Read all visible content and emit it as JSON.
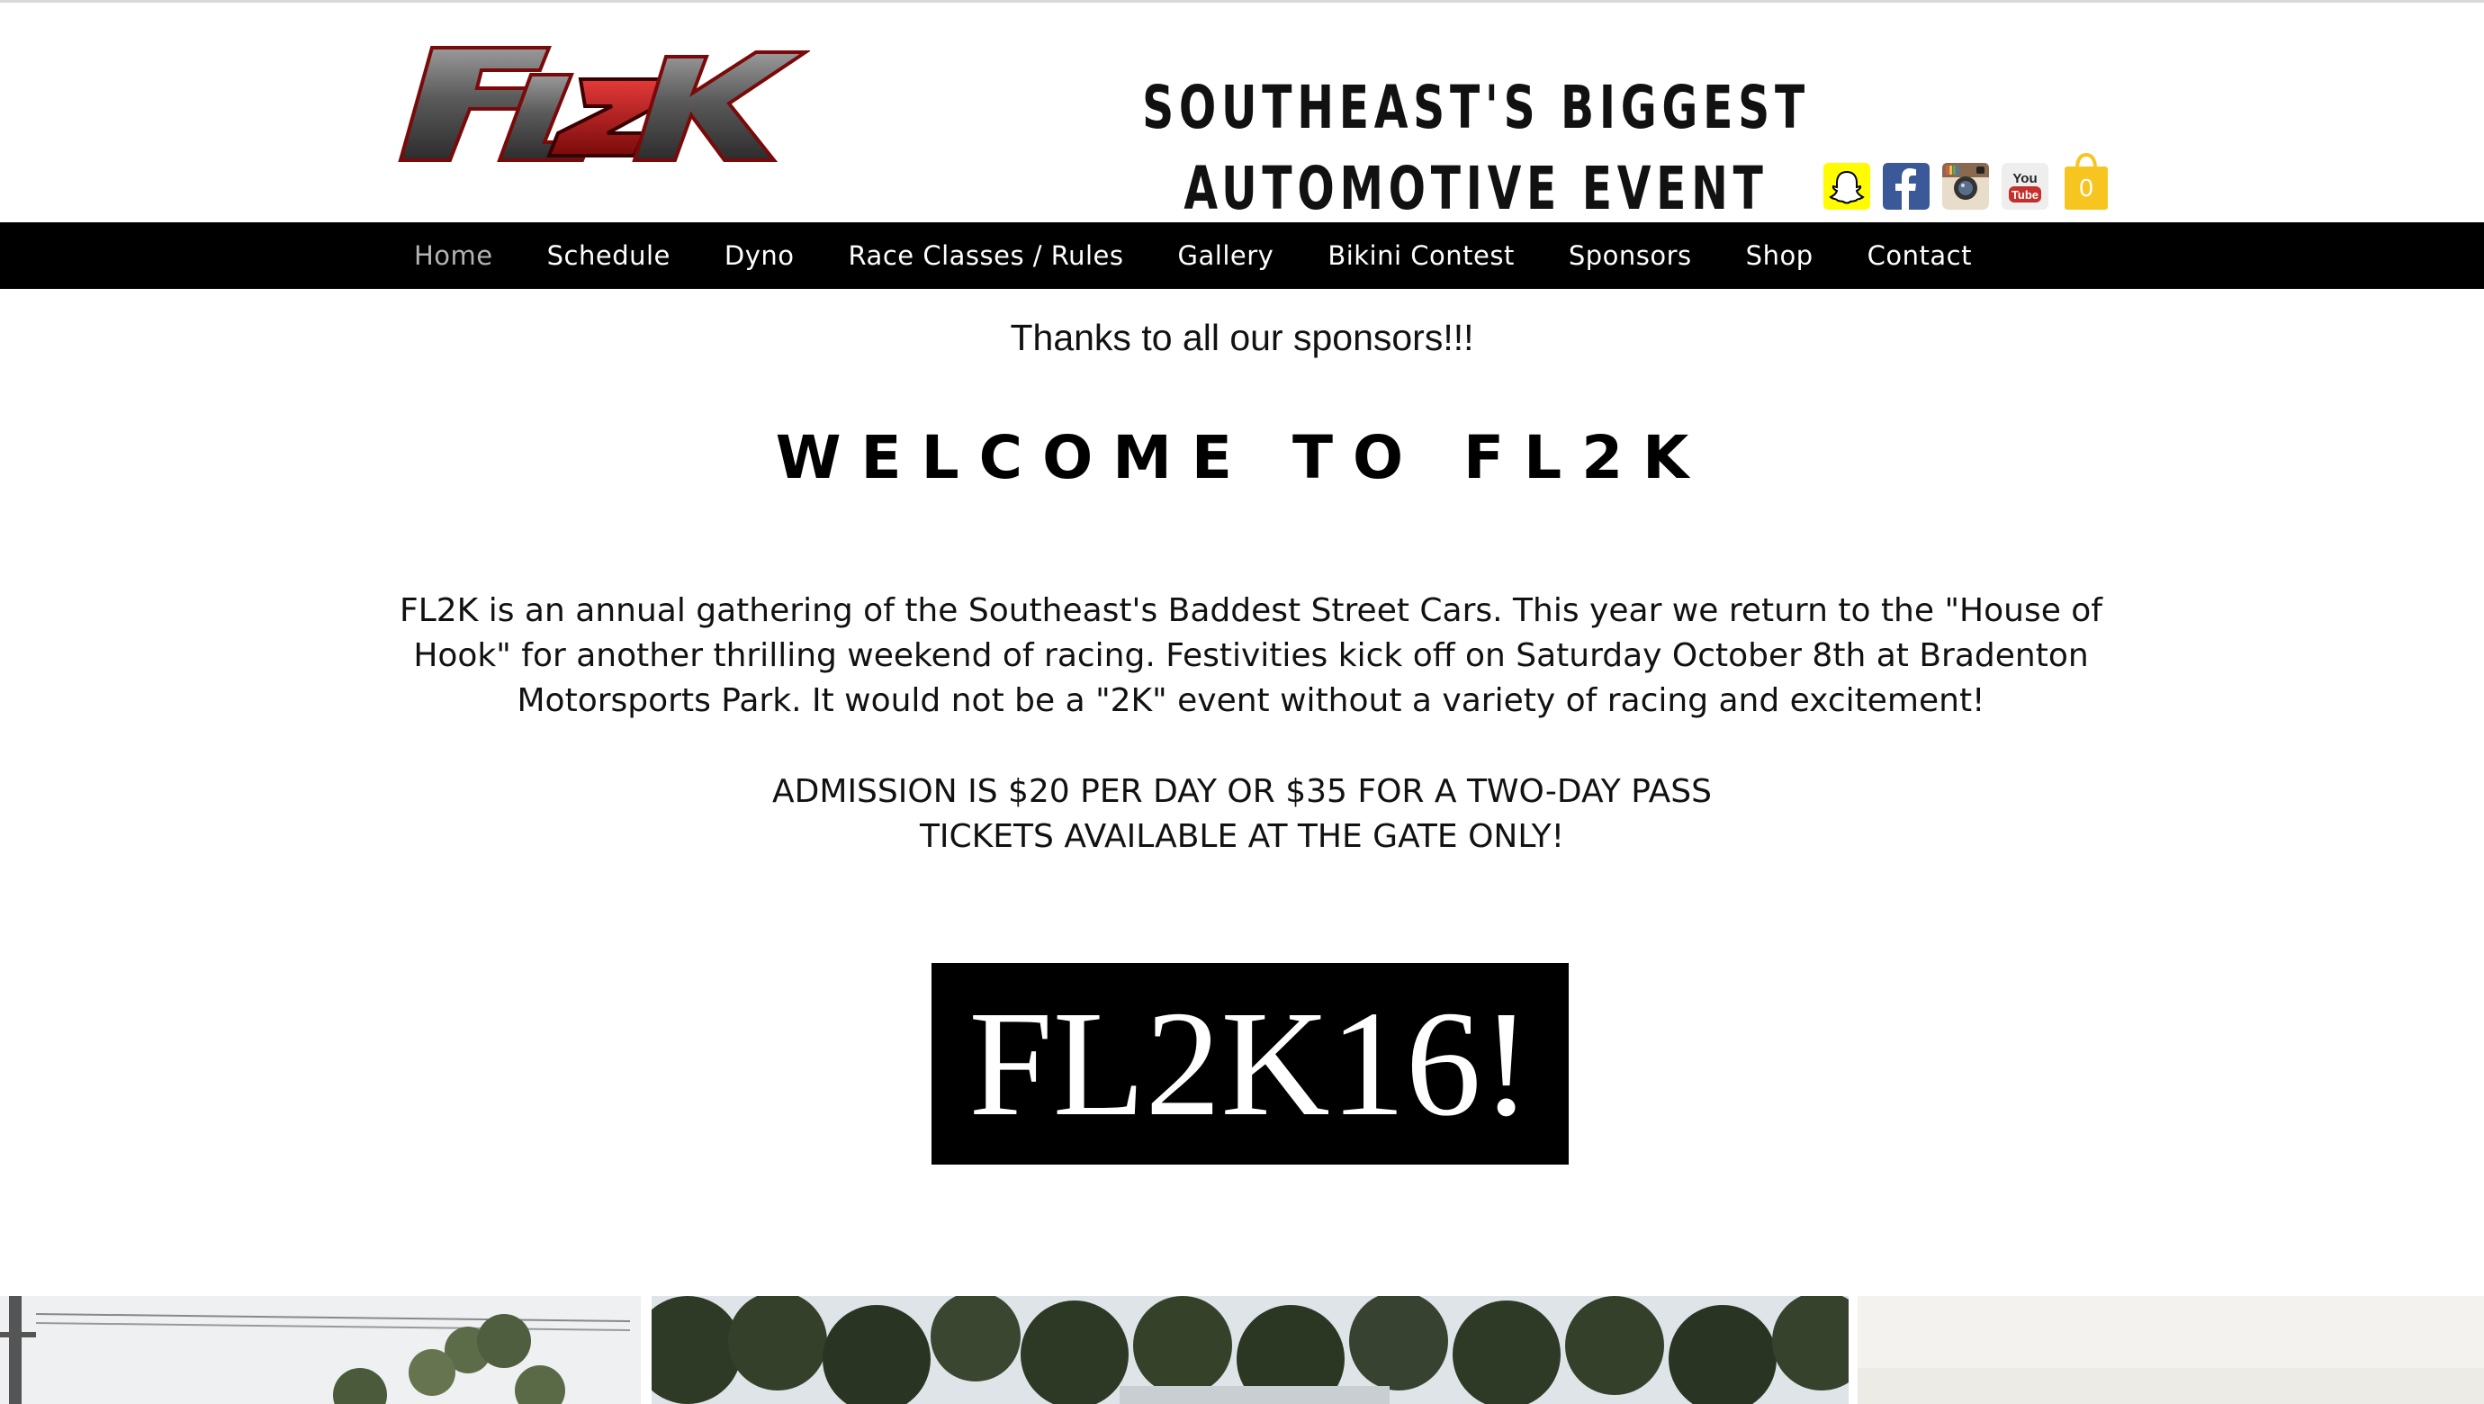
{
  "header": {
    "logo_text": "FL2K",
    "tagline": "SOUTHEAST'S BIGGEST AUTOMOTIVE EVENT",
    "social": [
      {
        "name": "snapchat-icon",
        "color": "#fffc00"
      },
      {
        "name": "facebook-icon",
        "color": "#3b5998"
      },
      {
        "name": "instagram-icon",
        "color": "#8a6a4f"
      },
      {
        "name": "youtube-icon",
        "color": "#c4302b"
      }
    ],
    "cart": {
      "icon": "shopping-bag-icon",
      "count": "0",
      "color": "#f7c520"
    }
  },
  "nav": {
    "items": [
      {
        "label": "Home",
        "active": true
      },
      {
        "label": "Schedule"
      },
      {
        "label": "Dyno"
      },
      {
        "label": "Race Classes / Rules"
      },
      {
        "label": "Gallery"
      },
      {
        "label": "Bikini Contest"
      },
      {
        "label": "Sponsors"
      },
      {
        "label": "Shop"
      },
      {
        "label": "Contact"
      }
    ]
  },
  "main": {
    "sponsors_text": "Thanks to all our sponsors!!!",
    "welcome_title": "WELCOME TO FL2K",
    "intro": "FL2K is an annual gathering of the Southeast's Baddest Street Cars. This year we return to the \"House of Hook\" for another thrilling weekend of racing. Festivities kick off on Saturday October 8th at Bradenton Motorsports Park. It would not be a \"2K\" event without a variety of racing and excitement!",
    "admission_line1": "ADMISSION IS $20 PER DAY OR $35 FOR A TWO-DAY PASS",
    "admission_line2": "TICKETS AVAILABLE AT THE GATE ONLY!",
    "banner_text": "FL2K16!"
  }
}
